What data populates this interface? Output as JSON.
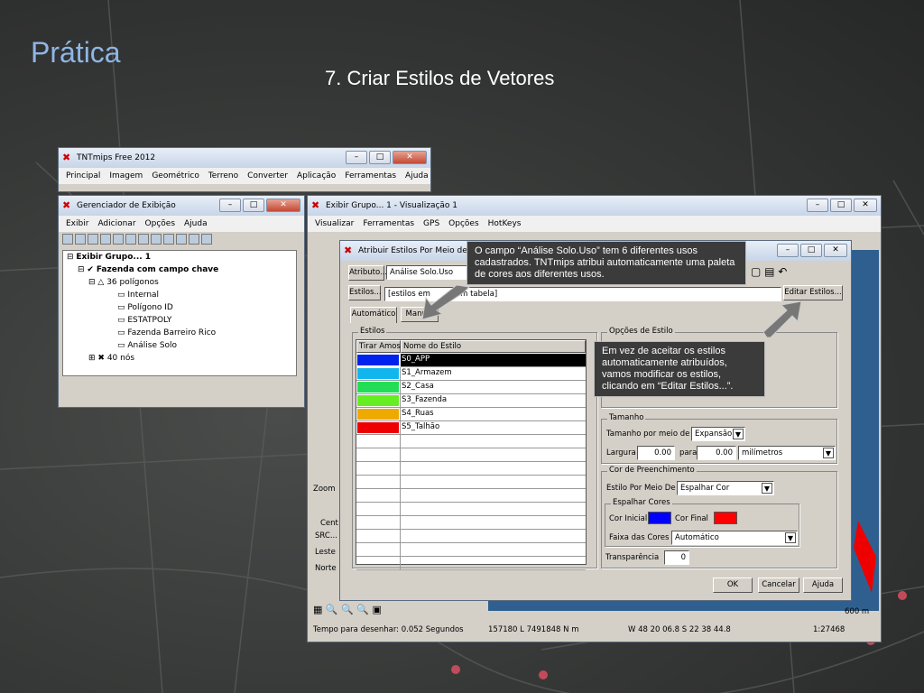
{
  "slide": {
    "title": "Prática",
    "subtitle": "7. Criar Estilos de Vetores"
  },
  "colors": {
    "title": "#8fb6e6",
    "accent_red": "#ee0000",
    "callout_bg": "#3b3b3b"
  },
  "tnt_window": {
    "title": "TNTmips Free 2012",
    "menu": [
      "Principal",
      "Imagem",
      "Geométrico",
      "Terreno",
      "Converter",
      "Aplicação",
      "Ferramentas",
      "Ajuda"
    ]
  },
  "display_manager": {
    "title": "Gerenciador de Exibição",
    "menu": [
      "Exibir",
      "Adicionar",
      "Opções",
      "Ajuda"
    ],
    "tree": [
      "Exibir Grupo... 1",
      "Fazenda com campo chave",
      "36 polígonos",
      "Internal",
      "Polígono ID",
      "ESTATPOLY",
      "Fazenda Barreiro Rico",
      "Análise Solo",
      "40 nós"
    ]
  },
  "view_window": {
    "title": "Exibir Grupo... 1 - Visualização 1",
    "menu": [
      "Visualizar",
      "Ferramentas",
      "GPS",
      "Opções",
      "HotKeys"
    ],
    "side_labels": {
      "zoom": "Zoom",
      "center": "Cent",
      "src": "SRC...",
      "east": "Leste",
      "north": "Norte"
    },
    "status": {
      "draw_time": "Tempo para desenhar: 0.052 Segundos",
      "coords": "157180 L  7491848 N m",
      "geo": "W 48 20 06.8  S 22 38 44.8",
      "scale": "1:27468",
      "scalebar": "600 m"
    }
  },
  "dialog": {
    "title": "Atribuir Estilos Por Meio de A",
    "attribute_btn": "Atributo...",
    "attribute_value": "Análise Solo.Uso",
    "styles_btn": "Estilos...",
    "styles_value": "[estilos em tabela]",
    "styles_value_left": "[estilos em",
    "styles_value_right": "em tabela]",
    "edit_styles_btn": "Editar Estilos...",
    "tabs": [
      "Automático",
      "Manual"
    ],
    "styles_group": "Estilos",
    "col_take": "Tirar Amos",
    "col_name": "Nome do Estilo",
    "styles": [
      {
        "name": "S0_APP",
        "color": "#0022ee"
      },
      {
        "name": "S1_Armazem",
        "color": "#11b6ee"
      },
      {
        "name": "S2_Casa",
        "color": "#22dd55"
      },
      {
        "name": "S3_Fazenda",
        "color": "#66ee22"
      },
      {
        "name": "S4_Ruas",
        "color": "#eeaa00"
      },
      {
        "name": "S5_Talhão",
        "color": "#ee0000"
      }
    ],
    "options_group": "Opções de Estilo",
    "size_group": "Tamanho",
    "size_by_label": "Tamanho por meio de",
    "size_by_value": "Expansão",
    "width_label": "Largura",
    "width_value": "0.00",
    "to_label": "para",
    "to_value": "0.00",
    "unit_value": "milímetros",
    "fill_group": "Cor de Preenchimento",
    "fill_by_label": "Estilo Por Meio De",
    "fill_by_value": "Espalhar Cor",
    "spread_group": "Espalhar Cores",
    "start_label": "Cor Inicial",
    "start_color": "#0000ff",
    "end_label": "Cor Final",
    "end_color": "#ff0000",
    "range_label": "Faixa das Cores",
    "range_value": "Automático",
    "transparency_label": "Transparência",
    "transparency_value": "0",
    "ok": "OK",
    "cancel": "Cancelar",
    "help": "Ajuda"
  },
  "callouts": [
    "O campo “Análise Solo.Uso” tem 6 diferentes usos cadastrados. TNTmips atribui automaticamente uma paleta de cores aos diferentes usos.",
    "Em vez de aceitar os estilos automaticamente atribuídos, vamos modificar os estilos, clicando em “Editar Estilos...”."
  ]
}
